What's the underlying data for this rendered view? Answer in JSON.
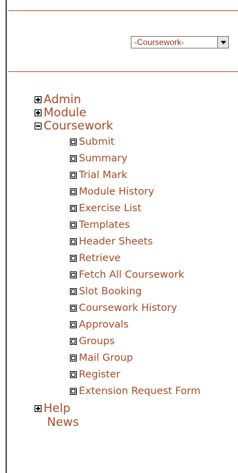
{
  "selector": {
    "value": "-Coursework-"
  },
  "menu": {
    "admin": "Admin",
    "module": "Module",
    "coursework": "Coursework",
    "coursework_items": [
      "Submit",
      "Summary",
      "Trial Mark",
      "Module History",
      "Exercise List",
      "Templates",
      "Header Sheets",
      "Retrieve",
      "Fetch All Coursework",
      "Slot Booking",
      "Coursework History",
      "Approvals",
      "Groups",
      "Mail Group",
      "Register",
      "Extension Request Form"
    ],
    "help": "Help",
    "news": "News"
  },
  "colors": {
    "link": "#a64b26",
    "rule": "#b5572e"
  }
}
